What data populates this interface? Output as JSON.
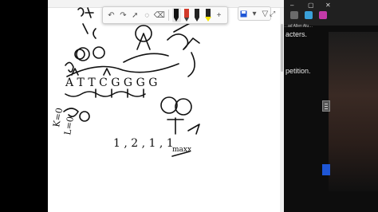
{
  "side_panel": {
    "title_snippet": "…ad Allen Alu…",
    "lines": [
      {
        "text": "acters."
      },
      {
        "text": "petition."
      }
    ]
  },
  "toolbar": {
    "tools": [
      "undo",
      "redo",
      "select",
      "lasso",
      "eraser"
    ],
    "pens": [
      {
        "name": "pen-black",
        "color": "#111111"
      },
      {
        "name": "pen-red",
        "color": "#d23a2a"
      },
      {
        "name": "pen-black-2",
        "color": "#222222"
      },
      {
        "name": "highlighter-yellow",
        "color": "#f5e400"
      }
    ]
  },
  "handwriting": {
    "equation_row": "1 , 2 , 1 , 1",
    "word": "maxx",
    "letters_row": "A T T C G G G G",
    "side_vars": [
      "K=0",
      "L=0"
    ]
  }
}
